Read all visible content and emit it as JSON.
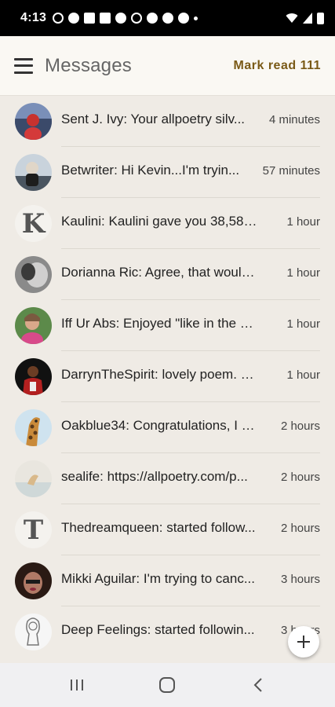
{
  "status_bar": {
    "time": "4:13"
  },
  "header": {
    "title": "Messages",
    "mark_read_label": "Mark read 111"
  },
  "messages": [
    {
      "text": "Sent J. Ivy: Your allpoetry silv...",
      "time": "4 minutes"
    },
    {
      "text": "Betwriter: Hi Kevin...I'm tryin...",
      "time": "57 minutes"
    },
    {
      "text": "Kaulini: Kaulini gave you 38,580 ...",
      "time": "1 hour",
      "avatar_letter": "K"
    },
    {
      "text": "Dorianna Ric: Agree, that would ...",
      "time": "1 hour"
    },
    {
      "text": "Iff Ur Abs: Enjoyed \"like in the w...",
      "time": "1 hour"
    },
    {
      "text": "DarrynTheSpirit: lovely poem. C...",
      "time": "1 hour"
    },
    {
      "text": "Oakblue34: Congratulations, I a...",
      "time": "2 hours"
    },
    {
      "text": "sealife: https://allpoetry.com/p...",
      "time": "2 hours"
    },
    {
      "text": "Thedreamqueen: started follow...",
      "time": "2 hours",
      "avatar_letter": "T"
    },
    {
      "text": "Mikki Aguilar: I'm trying to canc...",
      "time": "3 hours"
    },
    {
      "text": "Deep Feelings: started followin...",
      "time": "3 hours"
    }
  ],
  "colors": {
    "accent": "#7a5a17",
    "background": "#efebe5",
    "appbar": "#faf8f3"
  },
  "icons": {
    "menu": "hamburger-icon",
    "fab": "plus-icon",
    "nav": [
      "recent-apps-icon",
      "home-icon",
      "back-icon"
    ]
  }
}
